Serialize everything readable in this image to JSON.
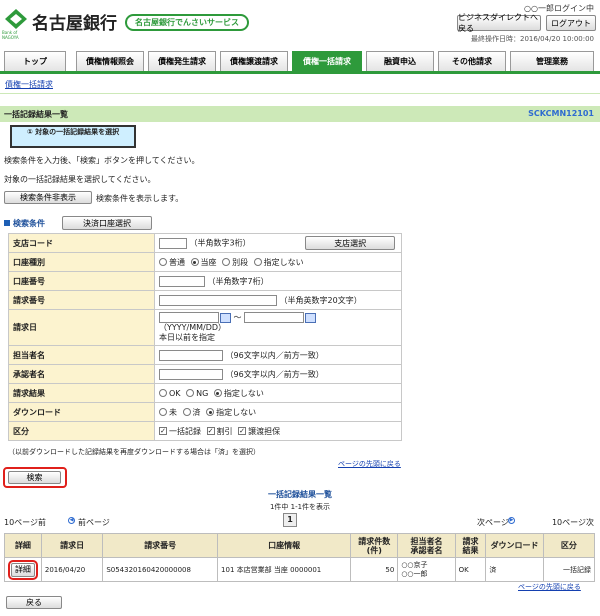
{
  "header": {
    "bank_name": "名古屋銀行",
    "service_name": "名古屋銀行でんさいサービス",
    "logo_sub": "Bank of NAGOYA",
    "user_login": "○○一郎ログイン中",
    "last_operation": "最終操作日時：2016/04/20 10:00:00",
    "business_direct_back": "ビジネスダイレクトへ戻る",
    "logout": "ログアウト"
  },
  "tabs": [
    {
      "label": "トップ",
      "active": false
    },
    {
      "label": "債権情報照会",
      "active": false
    },
    {
      "label": "債権発生請求",
      "active": false
    },
    {
      "label": "債権譲渡請求",
      "active": false
    },
    {
      "label": "債権一括請求",
      "active": true
    },
    {
      "label": "融資申込",
      "active": false
    },
    {
      "label": "その他請求",
      "active": false
    },
    {
      "label": "管理業務",
      "active": false
    }
  ],
  "subnav": {
    "link": "債権一括請求"
  },
  "page": {
    "title": "一括記録結果一覧",
    "screen_id": "SCKCMN12101",
    "step_label": "① 対象の一括記録結果を選択",
    "instruction1": "検索条件を入力後、「検索」ボタンを押してください。",
    "instruction2": "対象の一括記録結果を選択してください。",
    "toggle_button": "検索条件非表示",
    "toggle_desc": "検索条件を表示します。"
  },
  "search": {
    "heading": "検索条件",
    "account_select_button": "決済口座選択",
    "branch_label": "支店コード",
    "branch_hint": "（半角数字3桁）",
    "branch_select_button": "支店選択",
    "account_type_label": "口座種別",
    "account_type_options": [
      "普通",
      "当座",
      "別段",
      "指定しない"
    ],
    "account_type_selected": "当座",
    "account_no_label": "口座番号",
    "account_no_hint": "（半角数字7桁）",
    "request_no_label": "請求番号",
    "request_no_hint": "（半角英数字20文字）",
    "request_date_label": "請求日",
    "date_separator": "～",
    "date_format": "（YYYY/MM/DD）",
    "date_note": "本日以前を指定",
    "person_label": "担当者名",
    "person_hint": "（96文字以内／前方一致）",
    "approver_label": "承認者名",
    "approver_hint": "（96文字以内／前方一致）",
    "result_label": "請求結果",
    "result_options": [
      "OK",
      "NG",
      "指定しない"
    ],
    "result_selected": "指定しない",
    "download_label": "ダウンロード",
    "download_options": [
      "未",
      "済",
      "指定しない"
    ],
    "download_selected": "指定しない",
    "category_label": "区分",
    "category_options": [
      "一括記録",
      "割引",
      "譲渡担保"
    ],
    "note": "（以前ダウンロードした記録結果を再度ダウンロードする場合は「済」を選択）",
    "page_top_link": "ページの先頭に戻る",
    "search_button": "検索"
  },
  "results": {
    "title": "一括記録結果一覧",
    "count": "1件中 1-1件を表示",
    "prev10": "10ページ前",
    "prev": "前ページ",
    "page_number": "1",
    "next": "次ページ",
    "next10": "10ページ次",
    "columns": [
      "詳細",
      "請求日",
      "請求番号",
      "口座情報",
      "請求件数(件)",
      "担当者名承認者名",
      "請求結果",
      "ダウンロード",
      "区分"
    ],
    "col_labels": {
      "detail": "詳細",
      "date": "請求日",
      "number": "請求番号",
      "account": "口座情報",
      "count_l1": "請求件数",
      "count_l2": "(件)",
      "person_l1": "担当者名",
      "person_l2": "承認者名",
      "result_l1": "請求",
      "result_l2": "結果",
      "download": "ダウンロード",
      "category": "区分"
    },
    "rows": [
      {
        "detail_button": "詳細",
        "date": "2016/04/20",
        "number": "S054320160420000008",
        "account": "101 本店営業部 当座 0000001",
        "count": "50",
        "person": "○○京子",
        "approver": "○○一郎",
        "result": "OK",
        "download": "済",
        "category": "一括記録"
      }
    ],
    "page_top_link": "ページの先頭に戻る"
  },
  "footer": {
    "back_button": "戻る"
  },
  "colors": {
    "green": "#2e9a3b",
    "label_bg": "#fcf3cf",
    "header_bar": "#cde9b8",
    "highlight": "#e0201b"
  }
}
